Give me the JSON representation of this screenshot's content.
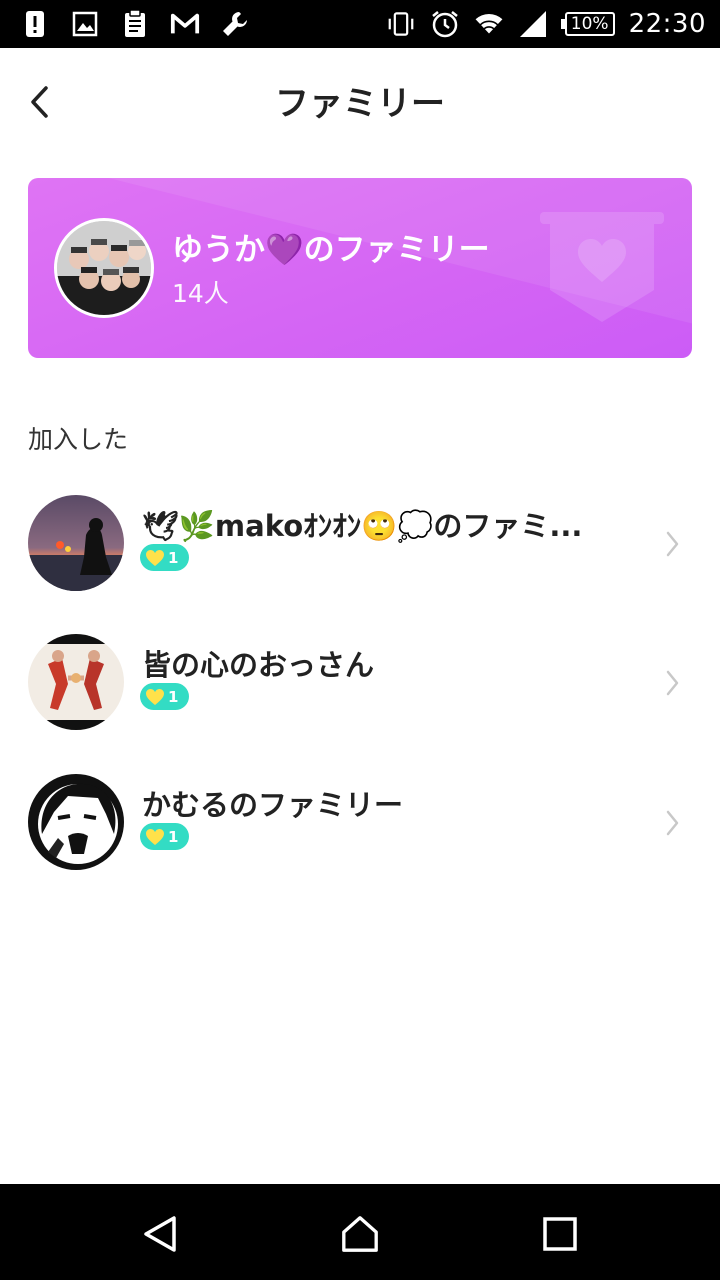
{
  "status_bar": {
    "time": "22:30",
    "battery": "10%",
    "left_icons": [
      "alert-icon",
      "image-icon",
      "clipboard-icon",
      "mail-m-icon",
      "wrench-icon"
    ],
    "right_icons": [
      "vibrate-icon",
      "alarm-icon",
      "wifi-icon",
      "signal-icon",
      "battery-icon"
    ]
  },
  "header": {
    "title": "ファミリー",
    "back_icon": "chevron-left-icon"
  },
  "family_card": {
    "name": "ゆうか💜のファミリー",
    "member_count": "14人",
    "badge_icon": "heart-banner-icon",
    "gradient_start": "#df74f4",
    "gradient_end": "#cc5cf6"
  },
  "section": {
    "joined_label": "加入した"
  },
  "joined_families": [
    {
      "name": "🕊🌿makoｵﾝｵﾝ🙄💭のファミ...",
      "level": "1"
    },
    {
      "name": "皆の心のおっさん",
      "level": "1"
    },
    {
      "name": "かむるのファミリー",
      "level": "1"
    }
  ],
  "colors": {
    "pill": "#33dcc4",
    "heart": "#ffe14a"
  },
  "nav_bar": {
    "icons": [
      "back-triangle-icon",
      "home-icon",
      "recents-icon"
    ]
  }
}
